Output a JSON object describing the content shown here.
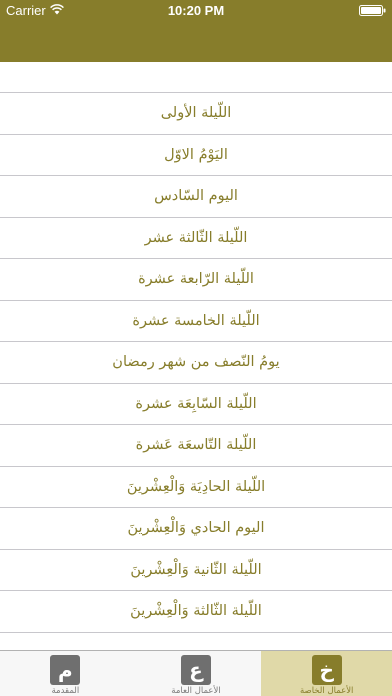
{
  "status": {
    "carrier": "Carrier",
    "time": "10:20 PM"
  },
  "list": {
    "items": [
      "اللّيلة الأولى",
      "اليَوْمُ الاوّل",
      "اليوم السّادس",
      "اللّيلة الثّالثة عشر",
      "اللّيلة الرّابعة عشرة",
      "اللّيلة الخامسة عشرة",
      "يومُ النّصف من شهر رمضان",
      "اللّيلة السّابِعَة عشرة",
      "اللّيلة التّاسعَة عَشرة",
      "اللّيلة الحادِيَة وَالْعِشْرينَ",
      "اليوم الحادي وَالْعِشْرينَ",
      "اللّيلة الثّانية وَالْعِشْرينَ",
      "اللّيلة الثّالثة وَالْعِشْرينَ"
    ]
  },
  "tabs": [
    {
      "glyph": "م",
      "label": "المقدمة"
    },
    {
      "glyph": "ع",
      "label": "الأعمال العامة"
    },
    {
      "glyph": "خ",
      "label": "الأعمال الخاصة"
    }
  ],
  "colors": {
    "accent": "#877d2b",
    "active_tab_bg": "#e0d9a8"
  }
}
